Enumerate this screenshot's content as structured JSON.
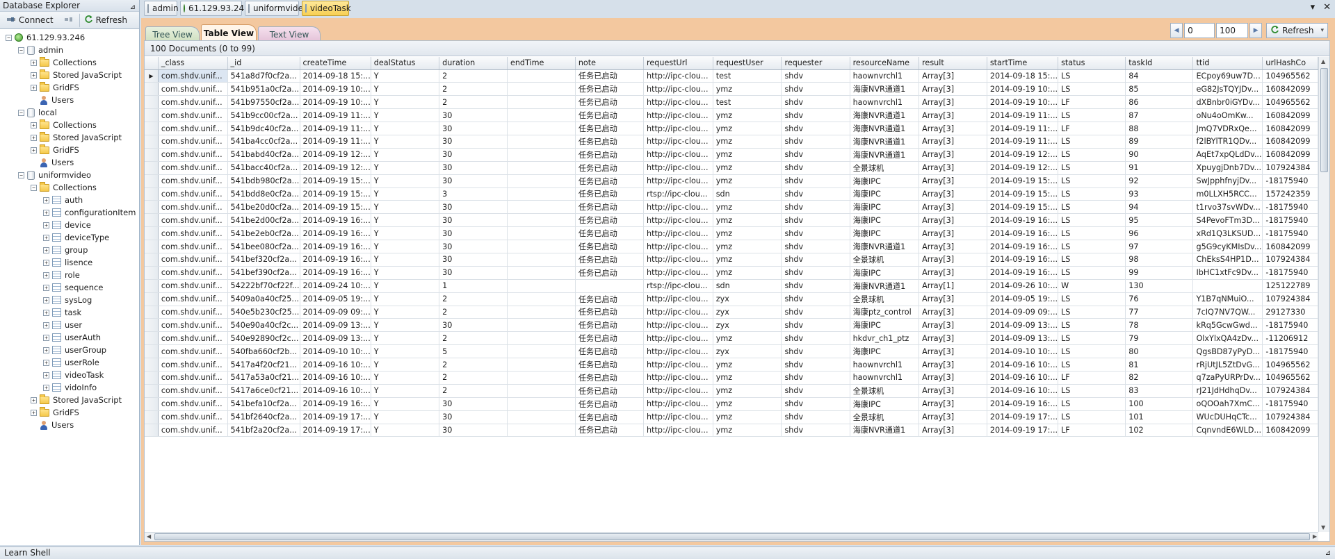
{
  "explorer": {
    "title": "Database Explorer",
    "connect_label": "Connect",
    "refresh_label": "Refresh",
    "tree": [
      {
        "label": "61.129.93.246",
        "level": 0,
        "icon": "server",
        "exp": "-"
      },
      {
        "label": "admin",
        "level": 1,
        "icon": "db",
        "exp": "-"
      },
      {
        "label": "Collections",
        "level": 2,
        "icon": "folder",
        "exp": "+"
      },
      {
        "label": "Stored JavaScript",
        "level": 2,
        "icon": "folder",
        "exp": "+"
      },
      {
        "label": "GridFS",
        "level": 2,
        "icon": "folder",
        "exp": "+"
      },
      {
        "label": "Users",
        "level": 2,
        "icon": "user",
        "exp": ""
      },
      {
        "label": "local",
        "level": 1,
        "icon": "db",
        "exp": "-"
      },
      {
        "label": "Collections",
        "level": 2,
        "icon": "folder",
        "exp": "+"
      },
      {
        "label": "Stored JavaScript",
        "level": 2,
        "icon": "folder",
        "exp": "+"
      },
      {
        "label": "GridFS",
        "level": 2,
        "icon": "folder",
        "exp": "+"
      },
      {
        "label": "Users",
        "level": 2,
        "icon": "user",
        "exp": ""
      },
      {
        "label": "uniformvideo",
        "level": 1,
        "icon": "db",
        "exp": "-"
      },
      {
        "label": "Collections",
        "level": 2,
        "icon": "folder",
        "exp": "-"
      },
      {
        "label": "auth",
        "level": 3,
        "icon": "table",
        "exp": "+"
      },
      {
        "label": "configurationItem",
        "level": 3,
        "icon": "table",
        "exp": "+"
      },
      {
        "label": "device",
        "level": 3,
        "icon": "table",
        "exp": "+"
      },
      {
        "label": "deviceType",
        "level": 3,
        "icon": "table",
        "exp": "+"
      },
      {
        "label": "group",
        "level": 3,
        "icon": "table",
        "exp": "+"
      },
      {
        "label": "lisence",
        "level": 3,
        "icon": "table",
        "exp": "+"
      },
      {
        "label": "role",
        "level": 3,
        "icon": "table",
        "exp": "+"
      },
      {
        "label": "sequence",
        "level": 3,
        "icon": "table",
        "exp": "+"
      },
      {
        "label": "sysLog",
        "level": 3,
        "icon": "table",
        "exp": "+"
      },
      {
        "label": "task",
        "level": 3,
        "icon": "table",
        "exp": "+"
      },
      {
        "label": "user",
        "level": 3,
        "icon": "table",
        "exp": "+"
      },
      {
        "label": "userAuth",
        "level": 3,
        "icon": "table",
        "exp": "+"
      },
      {
        "label": "userGroup",
        "level": 3,
        "icon": "table",
        "exp": "+"
      },
      {
        "label": "userRole",
        "level": 3,
        "icon": "table",
        "exp": "+"
      },
      {
        "label": "videoTask",
        "level": 3,
        "icon": "table",
        "exp": "+"
      },
      {
        "label": "vidoInfo",
        "level": 3,
        "icon": "table",
        "exp": "+"
      },
      {
        "label": "Stored JavaScript",
        "level": 2,
        "icon": "folder",
        "exp": "+"
      },
      {
        "label": "GridFS",
        "level": 2,
        "icon": "folder",
        "exp": "+"
      },
      {
        "label": "Users",
        "level": 2,
        "icon": "user",
        "exp": ""
      }
    ]
  },
  "toptabs": [
    {
      "label": "admin",
      "icon": "db",
      "active": false
    },
    {
      "label": "61.129.93.246",
      "icon": "server",
      "active": false
    },
    {
      "label": "uniformvideo",
      "icon": "db",
      "active": false
    },
    {
      "label": "videoTask",
      "icon": "table",
      "active": true
    }
  ],
  "views": {
    "tree": "Tree View",
    "table": "Table View",
    "text": "Text View",
    "active": "Table View"
  },
  "nav": {
    "skip": "0",
    "limit": "100",
    "refresh_label": "Refresh"
  },
  "grid": {
    "doc_count": "100 Documents (0 to 99)",
    "columns": [
      "_class",
      "_id",
      "createTime",
      "dealStatus",
      "duration",
      "endTime",
      "note",
      "requestUrl",
      "requestUser",
      "requester",
      "resourceName",
      "result",
      "startTime",
      "status",
      "taskId",
      "ttid",
      "urlHashCo"
    ],
    "rows": [
      [
        "com.shdv.unif...",
        "541a8d7f0cf2a...",
        "2014-09-18 15:...",
        "Y",
        "2",
        "",
        "任务已启动",
        "http://ipc-clou...",
        "test",
        "shdv",
        "haownvrchl1",
        "Array[3]",
        "2014-09-18 15:...",
        "LS",
        "84",
        "ECpoy69uw7D...",
        "104965562"
      ],
      [
        "com.shdv.unif...",
        "541b951a0cf2a...",
        "2014-09-19 10:...",
        "Y",
        "2",
        "",
        "任务已启动",
        "http://ipc-clou...",
        "ymz",
        "shdv",
        "海康NVR通道1",
        "Array[3]",
        "2014-09-19 10:...",
        "LS",
        "85",
        "eG82JsTQYJDv...",
        "160842099"
      ],
      [
        "com.shdv.unif...",
        "541b97550cf2a...",
        "2014-09-19 10:...",
        "Y",
        "2",
        "",
        "任务已启动",
        "http://ipc-clou...",
        "test",
        "shdv",
        "haownvrchl1",
        "Array[3]",
        "2014-09-19 10:...",
        "LF",
        "86",
        "dXBnbr0iGYDv...",
        "104965562"
      ],
      [
        "com.shdv.unif...",
        "541b9cc00cf2a...",
        "2014-09-19 11:...",
        "Y",
        "30",
        "",
        "任务已启动",
        "http://ipc-clou...",
        "ymz",
        "shdv",
        "海康NVR通道1",
        "Array[3]",
        "2014-09-19 11:...",
        "LS",
        "87",
        "oNu4oOmKw...",
        "160842099"
      ],
      [
        "com.shdv.unif...",
        "541b9dc40cf2a...",
        "2014-09-19 11:...",
        "Y",
        "30",
        "",
        "任务已启动",
        "http://ipc-clou...",
        "ymz",
        "shdv",
        "海康NVR通道1",
        "Array[3]",
        "2014-09-19 11:...",
        "LF",
        "88",
        "JmQ7VDRxQe...",
        "160842099"
      ],
      [
        "com.shdv.unif...",
        "541ba4cc0cf2a...",
        "2014-09-19 11:...",
        "Y",
        "30",
        "",
        "任务已启动",
        "http://ipc-clou...",
        "ymz",
        "shdv",
        "海康NVR通道1",
        "Array[3]",
        "2014-09-19 11:...",
        "LS",
        "89",
        "f2lBYlTR1QDv...",
        "160842099"
      ],
      [
        "com.shdv.unif...",
        "541babd40cf2a...",
        "2014-09-19 12:...",
        "Y",
        "30",
        "",
        "任务已启动",
        "http://ipc-clou...",
        "ymz",
        "shdv",
        "海康NVR通道1",
        "Array[3]",
        "2014-09-19 12:...",
        "LS",
        "90",
        "AqEt7xpQLdDv...",
        "160842099"
      ],
      [
        "com.shdv.unif...",
        "541bacc40cf2a...",
        "2014-09-19 12:...",
        "Y",
        "30",
        "",
        "任务已启动",
        "http://ipc-clou...",
        "ymz",
        "shdv",
        "全景球机",
        "Array[3]",
        "2014-09-19 12:...",
        "LS",
        "91",
        "XpuygjDnb7Dv...",
        "107924384"
      ],
      [
        "com.shdv.unif...",
        "541bdb980cf2a...",
        "2014-09-19 15:...",
        "Y",
        "30",
        "",
        "任务已启动",
        "http://ipc-clou...",
        "ymz",
        "shdv",
        "海康IPC",
        "Array[3]",
        "2014-09-19 15:...",
        "LS",
        "92",
        "SwJpphfnyjDv...",
        "-18175940"
      ],
      [
        "com.shdv.unif...",
        "541bdd8e0cf2a...",
        "2014-09-19 15:...",
        "Y",
        "3",
        "",
        "任务已启动",
        "rtsp://ipc-clou...",
        "sdn",
        "shdv",
        "海康IPC",
        "Array[3]",
        "2014-09-19 15:...",
        "LS",
        "93",
        "m0LLXH5RCC...",
        "157242359"
      ],
      [
        "com.shdv.unif...",
        "541be20d0cf2a...",
        "2014-09-19 15:...",
        "Y",
        "30",
        "",
        "任务已启动",
        "http://ipc-clou...",
        "ymz",
        "shdv",
        "海康IPC",
        "Array[3]",
        "2014-09-19 15:...",
        "LS",
        "94",
        "t1rvo37svWDv...",
        "-18175940"
      ],
      [
        "com.shdv.unif...",
        "541be2d00cf2a...",
        "2014-09-19 16:...",
        "Y",
        "30",
        "",
        "任务已启动",
        "http://ipc-clou...",
        "ymz",
        "shdv",
        "海康IPC",
        "Array[3]",
        "2014-09-19 16:...",
        "LS",
        "95",
        "S4PevoFTm3D...",
        "-18175940"
      ],
      [
        "com.shdv.unif...",
        "541be2eb0cf2a...",
        "2014-09-19 16:...",
        "Y",
        "30",
        "",
        "任务已启动",
        "http://ipc-clou...",
        "ymz",
        "shdv",
        "海康IPC",
        "Array[3]",
        "2014-09-19 16:...",
        "LS",
        "96",
        "xRd1Q3LKSUD...",
        "-18175940"
      ],
      [
        "com.shdv.unif...",
        "541bee080cf2a...",
        "2014-09-19 16:...",
        "Y",
        "30",
        "",
        "任务已启动",
        "http://ipc-clou...",
        "ymz",
        "shdv",
        "海康NVR通道1",
        "Array[3]",
        "2014-09-19 16:...",
        "LS",
        "97",
        "g5G9cyKMIsDv...",
        "160842099"
      ],
      [
        "com.shdv.unif...",
        "541bef320cf2a...",
        "2014-09-19 16:...",
        "Y",
        "30",
        "",
        "任务已启动",
        "http://ipc-clou...",
        "ymz",
        "shdv",
        "全景球机",
        "Array[3]",
        "2014-09-19 16:...",
        "LS",
        "98",
        "ChEksS4HP1D...",
        "107924384"
      ],
      [
        "com.shdv.unif...",
        "541bef390cf2a...",
        "2014-09-19 16:...",
        "Y",
        "30",
        "",
        "任务已启动",
        "http://ipc-clou...",
        "ymz",
        "shdv",
        "海康IPC",
        "Array[3]",
        "2014-09-19 16:...",
        "LS",
        "99",
        "IbHC1xtFc9Dv...",
        "-18175940"
      ],
      [
        "com.shdv.unif...",
        "54222bf70cf22f...",
        "2014-09-24 10:...",
        "Y",
        "1",
        "",
        "",
        "rtsp://ipc-clou...",
        "sdn",
        "shdv",
        "海康NVR通道1",
        "Array[1]",
        "2014-09-26 10:...",
        "W",
        "130",
        "",
        "125122789"
      ],
      [
        "com.shdv.unif...",
        "5409a0a40cf25...",
        "2014-09-05 19:...",
        "Y",
        "2",
        "",
        "任务已启动",
        "http://ipc-clou...",
        "zyx",
        "shdv",
        "全景球机",
        "Array[3]",
        "2014-09-05 19:...",
        "LS",
        "76",
        "Y1B7qNMuiO...",
        "107924384"
      ],
      [
        "com.shdv.unif...",
        "540e5b230cf25...",
        "2014-09-09 09:...",
        "Y",
        "2",
        "",
        "任务已启动",
        "http://ipc-clou...",
        "zyx",
        "shdv",
        "海康ptz_control",
        "Array[3]",
        "2014-09-09 09:...",
        "LS",
        "77",
        "7cIQ7NV7QW...",
        "29127330"
      ],
      [
        "com.shdv.unif...",
        "540e90a40cf2c...",
        "2014-09-09 13:...",
        "Y",
        "30",
        "",
        "任务已启动",
        "http://ipc-clou...",
        "zyx",
        "shdv",
        "海康IPC",
        "Array[3]",
        "2014-09-09 13:...",
        "LS",
        "78",
        "kRq5GcwGwd...",
        "-18175940"
      ],
      [
        "com.shdv.unif...",
        "540e92890cf2c...",
        "2014-09-09 13:...",
        "Y",
        "2",
        "",
        "任务已启动",
        "http://ipc-clou...",
        "ymz",
        "shdv",
        "hkdvr_ch1_ptz",
        "Array[3]",
        "2014-09-09 13:...",
        "LS",
        "79",
        "OlxYlxQA4zDv...",
        "-11206912"
      ],
      [
        "com.shdv.unif...",
        "540fba660cf2b...",
        "2014-09-10 10:...",
        "Y",
        "5",
        "",
        "任务已启动",
        "http://ipc-clou...",
        "zyx",
        "shdv",
        "海康IPC",
        "Array[3]",
        "2014-09-10 10:...",
        "LS",
        "80",
        "QgsBD87yPyD...",
        "-18175940"
      ],
      [
        "com.shdv.unif...",
        "5417a4f20cf21...",
        "2014-09-16 10:...",
        "Y",
        "2",
        "",
        "任务已启动",
        "http://ipc-clou...",
        "ymz",
        "shdv",
        "haownvrchl1",
        "Array[3]",
        "2014-09-16 10:...",
        "LS",
        "81",
        "rRjUtJL5ZtDvG...",
        "104965562"
      ],
      [
        "com.shdv.unif...",
        "5417a53a0cf21...",
        "2014-09-16 10:...",
        "Y",
        "2",
        "",
        "任务已启动",
        "http://ipc-clou...",
        "ymz",
        "shdv",
        "haownvrchl1",
        "Array[3]",
        "2014-09-16 10:...",
        "LF",
        "82",
        "q7zaPyURPrDv...",
        "104965562"
      ],
      [
        "com.shdv.unif...",
        "5417a6ce0cf21...",
        "2014-09-16 10:...",
        "Y",
        "2",
        "",
        "任务已启动",
        "http://ipc-clou...",
        "ymz",
        "shdv",
        "全景球机",
        "Array[3]",
        "2014-09-16 10:...",
        "LS",
        "83",
        "rJ21JdHdhqDv...",
        "107924384"
      ],
      [
        "com.shdv.unif...",
        "541befa10cf2a...",
        "2014-09-19 16:...",
        "Y",
        "30",
        "",
        "任务已启动",
        "http://ipc-clou...",
        "ymz",
        "shdv",
        "海康IPC",
        "Array[3]",
        "2014-09-19 16:...",
        "LS",
        "100",
        "oQOOah7XmC...",
        "-18175940"
      ],
      [
        "com.shdv.unif...",
        "541bf2640cf2a...",
        "2014-09-19 17:...",
        "Y",
        "30",
        "",
        "任务已启动",
        "http://ipc-clou...",
        "ymz",
        "shdv",
        "全景球机",
        "Array[3]",
        "2014-09-19 17:...",
        "LS",
        "101",
        "WUcDUHqCTc...",
        "107924384"
      ],
      [
        "com.shdv.unif...",
        "541bf2a20cf2a...",
        "2014-09-19 17:...",
        "Y",
        "30",
        "",
        "任务已启动",
        "http://ipc-clou...",
        "ymz",
        "shdv",
        "海康NVR通道1",
        "Array[3]",
        "2014-09-19 17:...",
        "LF",
        "102",
        "CqnvndE6WLD...",
        "160842099"
      ]
    ]
  },
  "bottom": {
    "label": "Learn Shell"
  }
}
